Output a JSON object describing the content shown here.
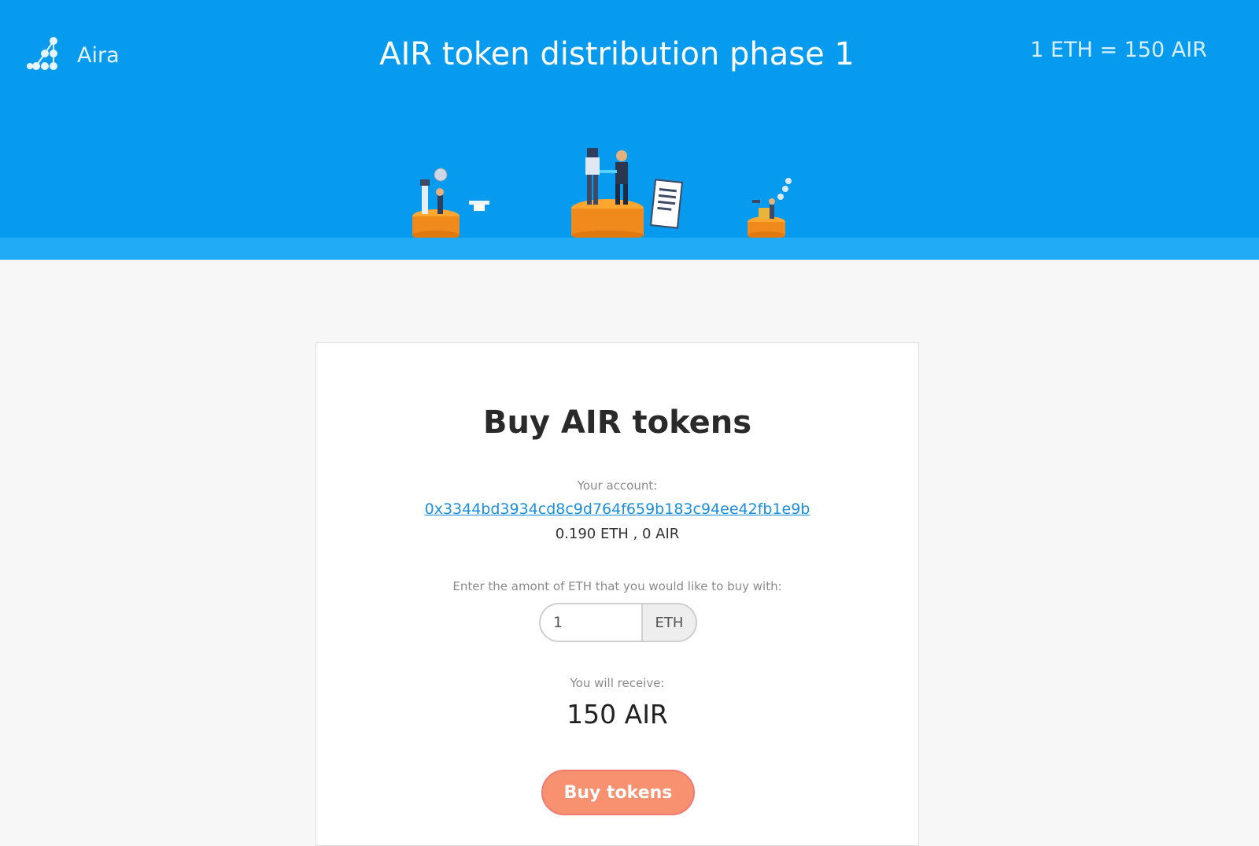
{
  "header": {
    "logo_text": "Aira",
    "title": "AIR token distribution phase 1",
    "rate": "1 ETH = 150 AIR",
    "illustration_icons": [
      "robot-handshake-icon",
      "drone-icon",
      "document-binary-icon",
      "coins-icon"
    ]
  },
  "card": {
    "title": "Buy AIR tokens",
    "account_label": "Your account:",
    "account_address": "0x3344bd3934cd8c9d764f659b183c94ee42fb1e9b",
    "balance": "0.190 ETH , 0 AIR",
    "amount_label": "Enter the amont of ETH that you would like to buy with:",
    "amount_value": "1",
    "amount_unit": "ETH",
    "receive_label": "You will receive:",
    "receive_value": "150 AIR",
    "buy_button": "Buy tokens"
  },
  "colors": {
    "header_bg": "#069bee",
    "header_strip": "#21abf7",
    "link": "#1a8fe0",
    "button": "#f7916f"
  }
}
